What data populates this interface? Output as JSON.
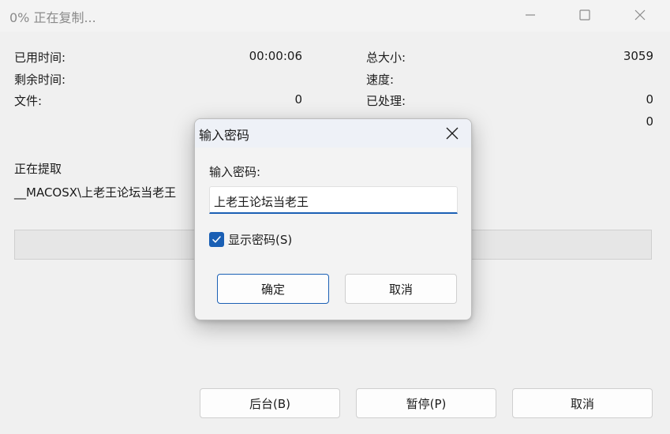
{
  "window": {
    "title": "0% 正在复制..."
  },
  "stats": {
    "elapsed_label": "已用时间:",
    "elapsed_value": "00:00:06",
    "remaining_label": "剩余时间:",
    "files_label": "文件:",
    "files_value": "0",
    "total_size_label": "总大小:",
    "total_size_value": "3059",
    "speed_label": "速度:",
    "processed_label": "已处理:",
    "processed_value": "0",
    "compressed_value": "0"
  },
  "extract": {
    "status_label": "正在提取",
    "current_path": "__MACOSX\\上老王论坛当老王"
  },
  "progress": {
    "percent": 0,
    "fill_color": "#2f9e44"
  },
  "buttons": {
    "background_label": "后台(B)",
    "pause_label": "暂停(P)",
    "cancel_label": "取消"
  },
  "dialog": {
    "title": "输入密码",
    "field_label": "输入密码:",
    "password_value": "上老王论坛当老王",
    "show_password_label": "显示密码(S)",
    "show_password_checked": true,
    "ok_label": "确定",
    "cancel_label": "取消",
    "accent_color": "#1a5fb4"
  }
}
